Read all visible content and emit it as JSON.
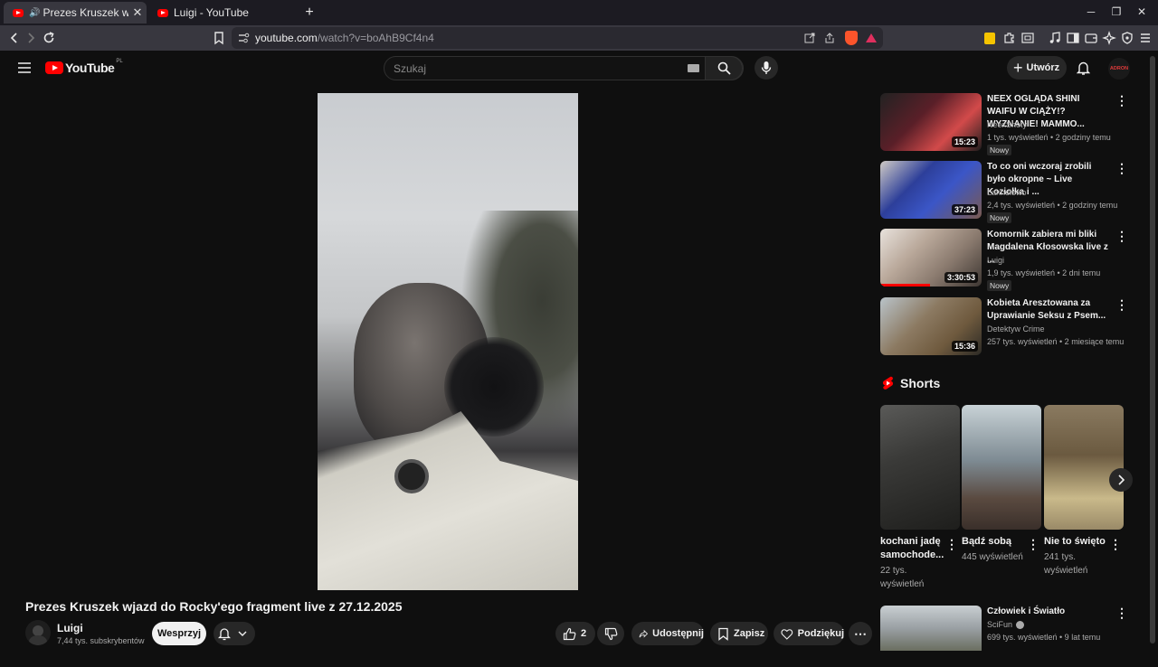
{
  "browser": {
    "tabs": [
      {
        "label": "Prezes Kruszek wjazd do Rocky",
        "active": true
      },
      {
        "label": "Luigi - YouTube",
        "active": false
      }
    ],
    "new_tab": "+",
    "close": "✕",
    "url_host": "youtube.com",
    "url_path": "/watch?v=boAhB9Cf4n4"
  },
  "youtube": {
    "logo_text": "YouTube",
    "region": "PL",
    "search_placeholder": "Szukaj",
    "create_label": "Utwórz",
    "avatar_text": "ADRON"
  },
  "video": {
    "title": "Prezes Kruszek wjazd do Rocky'ego fragment live z 27.12.2025",
    "channel": "Luigi",
    "subscribers": "7,44 tys. subskrybentów",
    "support_label": "Wesprzyj",
    "likes": "2",
    "share_label": "Udostępnij",
    "save_label": "Zapisz",
    "thanks_label": "Podziękuj"
  },
  "recommendations": [
    {
      "title": "NEEX OGLĄDA SHINI WAIFU W CIĄŻY!? WYZNANIE! MAMMO...",
      "channel": "NeexShoty",
      "meta": "1 tys. wyświetleń • 2 godziny temu",
      "badge": "Nowy",
      "duration": "15:23",
      "thumb_color": "#5a1f28"
    },
    {
      "title": "To co oni wczoraj zrobili było okropne ~ Live Koziołka i ...",
      "channel": "Lannelowo",
      "meta": "2,4 tys. wyświetleń • 2 godziny temu",
      "badge": "Nowy",
      "duration": "37:23",
      "thumb_color": "#2d3f9a"
    },
    {
      "title": "Komornik zabiera mi bliki Magdalena Kłosowska live z ...",
      "channel": "Luigi",
      "meta": "1,9 tys. wyświetleń • 2 dni temu",
      "badge": "Nowy",
      "duration": "3:30:53",
      "thumb_color": "#8a7a6e"
    },
    {
      "title": "Kobieta Aresztowana za Uprawianie Seksu z Psem...",
      "channel": "Detektyw Crime",
      "meta": "257 tys. wyświetleń • 2 miesiące temu",
      "badge": "",
      "duration": "15:36",
      "thumb_color": "#6f5a3e"
    }
  ],
  "shorts": {
    "heading": "Shorts",
    "items": [
      {
        "title": "kochani jadę samochode...",
        "views": "22 tys. wyświetleń",
        "color": "#3a3a38"
      },
      {
        "title": "Bądź sobą",
        "views": "445 wyświetleń",
        "color": "#7d8a92"
      },
      {
        "title": "Nie to święto",
        "views": "241 tys. wyświetleń",
        "color": "#6b5a40"
      }
    ]
  },
  "next_rec": {
    "title": "Człowiek i Światło",
    "channel": "SciFun",
    "meta": "699 tys. wyświetleń • 9 lat temu",
    "thumb_color": "#9aa0a4"
  }
}
